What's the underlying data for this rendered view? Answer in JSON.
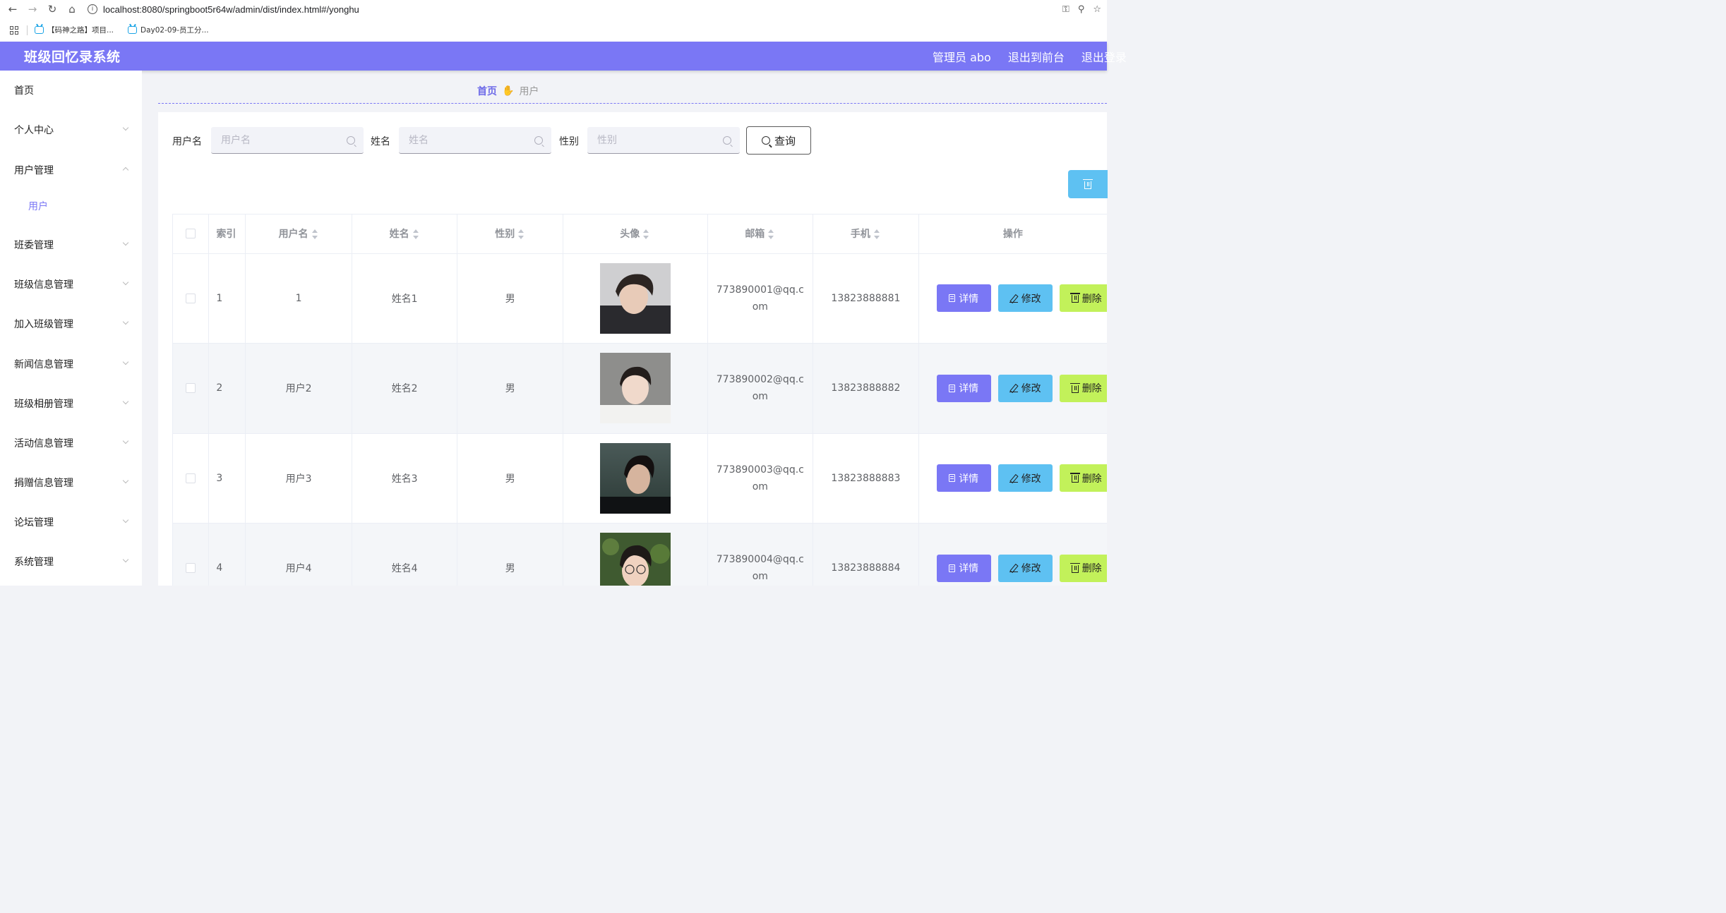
{
  "browser": {
    "url": "localhost:8080/springboot5r64w/admin/dist/index.html#/yonghu",
    "bookmarks": [
      {
        "label": "【码神之路】项目..."
      },
      {
        "label": "Day02-09-员工分..."
      }
    ]
  },
  "header": {
    "title": "班级回忆录系统",
    "user_label": "管理员 abo",
    "to_front_label": "退出到前台",
    "logout_label": "退出登录"
  },
  "sidebar": {
    "items": [
      {
        "label": "首页"
      },
      {
        "label": "个人中心"
      },
      {
        "label": "用户管理"
      },
      {
        "label": "班委管理"
      },
      {
        "label": "班级信息管理"
      },
      {
        "label": "加入班级管理"
      },
      {
        "label": "新闻信息管理"
      },
      {
        "label": "班级相册管理"
      },
      {
        "label": "活动信息管理"
      },
      {
        "label": "捐赠信息管理"
      },
      {
        "label": "论坛管理"
      },
      {
        "label": "系统管理"
      }
    ],
    "active_sub": {
      "label": "用户"
    }
  },
  "breadcrumb": {
    "home": "首页",
    "current": "用户"
  },
  "search": {
    "username_label": "用户名",
    "username_placeholder": "用户名",
    "name_label": "姓名",
    "name_placeholder": "姓名",
    "gender_label": "性别",
    "gender_placeholder": "性别",
    "query_label": "查询"
  },
  "table": {
    "columns": [
      "索引",
      "用户名",
      "姓名",
      "性别",
      "头像",
      "邮箱",
      "手机",
      "操作"
    ],
    "rows": [
      {
        "index": "1",
        "username": "1",
        "name": "姓名1",
        "gender": "男",
        "email": "773890001@qq.com",
        "phone": "13823888881"
      },
      {
        "index": "2",
        "username": "用户2",
        "name": "姓名2",
        "gender": "男",
        "email": "773890002@qq.com",
        "phone": "13823888882"
      },
      {
        "index": "3",
        "username": "用户3",
        "name": "姓名3",
        "gender": "男",
        "email": "773890003@qq.com",
        "phone": "13823888883"
      },
      {
        "index": "4",
        "username": "用户4",
        "name": "姓名4",
        "gender": "男",
        "email": "773890004@qq.com",
        "phone": "13823888884"
      }
    ],
    "actions": {
      "detail": "详情",
      "edit": "修改",
      "delete": "删除"
    }
  },
  "colors": {
    "primary": "#7a77f5",
    "info": "#5ec1f2",
    "danger": "#c2f15a"
  }
}
